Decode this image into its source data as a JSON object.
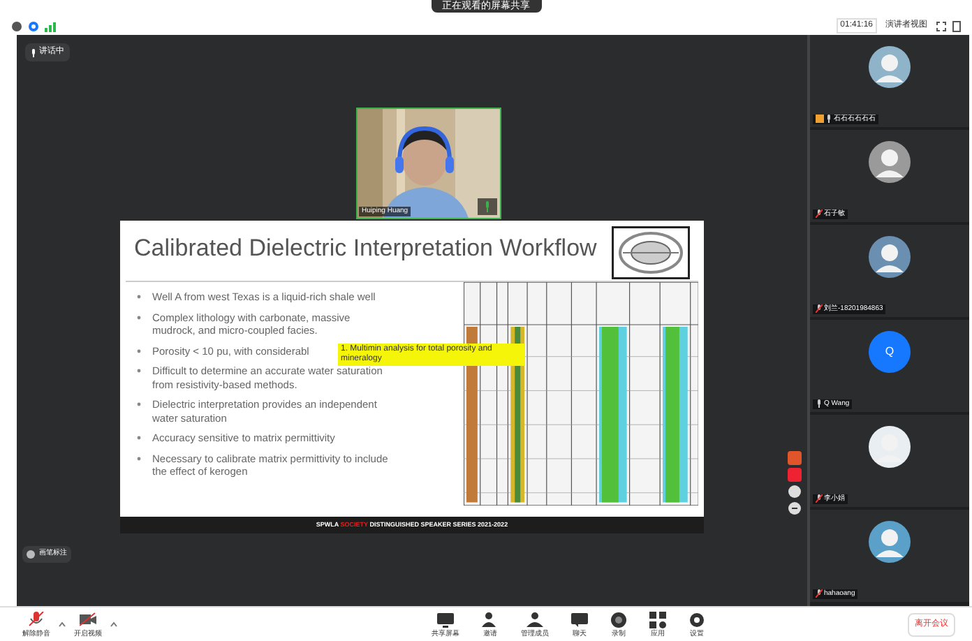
{
  "top_banner": {
    "text": "正在观看的屏幕共享"
  },
  "status_bar": {
    "timer": "01:41:16",
    "view_button": "演讲者视图"
  },
  "speaker_chip": {
    "label": "讲话中"
  },
  "video_tile": {
    "name": "Huiping Huang",
    "muted": false
  },
  "slide": {
    "title": "Calibrated Dielectric Interpretation Workflow",
    "bullets": [
      "Well A from west Texas is a liquid-rich shale well",
      "Complex lithology with carbonate, massive mudrock, and micro-coupled facies.",
      "Porosity < 10 pu, with considerabl",
      "Difficult to determine an accurate water saturation from resistivity-based methods.",
      "Dielectric interpretation provides an independent water saturation",
      "Accuracy sensitive to matrix permittivity",
      "Necessary to calibrate matrix permittivity to include the effect of kerogen"
    ],
    "callout": "1. Multimin analysis for total porosity and mineralogy",
    "footer": "SPWLA **SOCIETY** DISTINGUISHED SPEAKER SERIES 2021-2022"
  },
  "annotation_chip": {
    "label": "画笔标注"
  },
  "participants": [
    {
      "name": "石石石石石石",
      "muted": false,
      "host": true
    },
    {
      "name": "石子敏",
      "muted": true,
      "host": false
    },
    {
      "name": "刘兰-18201984863",
      "muted": true,
      "host": false
    },
    {
      "name": "Q Wang",
      "initial": "Q",
      "muted": false,
      "host": false
    },
    {
      "name": "李小娟",
      "muted": true,
      "host": false
    },
    {
      "name": "hahaoang",
      "muted": true,
      "host": false
    }
  ],
  "toolbar": {
    "left": [
      {
        "kind": "mic",
        "label": "解除静音"
      },
      {
        "kind": "video",
        "label": "开启视频"
      }
    ],
    "center": [
      {
        "kind": "share",
        "label": "共享屏幕"
      },
      {
        "kind": "invite",
        "label": "邀请"
      },
      {
        "kind": "members",
        "label": "管理成员"
      },
      {
        "kind": "chat",
        "label": "聊天"
      },
      {
        "kind": "record",
        "label": "录制"
      },
      {
        "kind": "apps",
        "label": "应用"
      },
      {
        "kind": "settings",
        "label": "设置"
      }
    ],
    "leave_button": "离开会议"
  }
}
